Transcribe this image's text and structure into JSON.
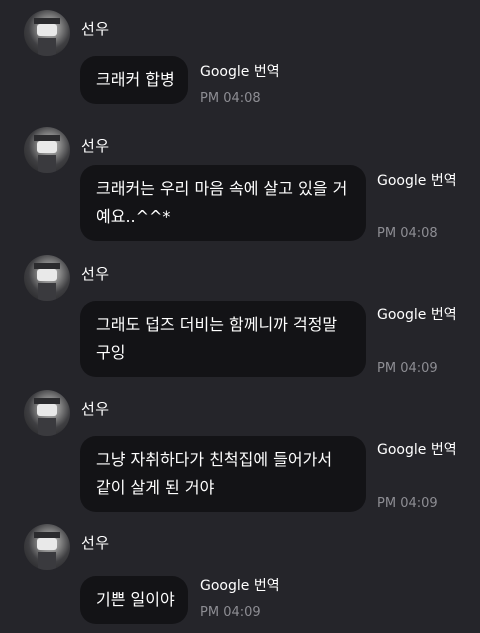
{
  "sender_name": "선우",
  "translate_label": "Google 번역",
  "messages": [
    {
      "lines": [
        "크래커 합병"
      ],
      "time": "PM 04:08"
    },
    {
      "lines": [
        "크래커는 우리 마음 속에 살고 있을 거",
        "예요..^^*"
      ],
      "time": "PM 04:08"
    },
    {
      "lines": [
        "그래도 덥즈 더비는 함께니까 걱정말",
        "구잉"
      ],
      "time": "PM 04:09"
    },
    {
      "lines": [
        "그냥 자취하다가 친척집에 들어가서",
        "같이 살게 된 거야"
      ],
      "time": "PM 04:09"
    },
    {
      "lines": [
        "기쁜 일이야"
      ],
      "time": "PM 04:09"
    }
  ]
}
